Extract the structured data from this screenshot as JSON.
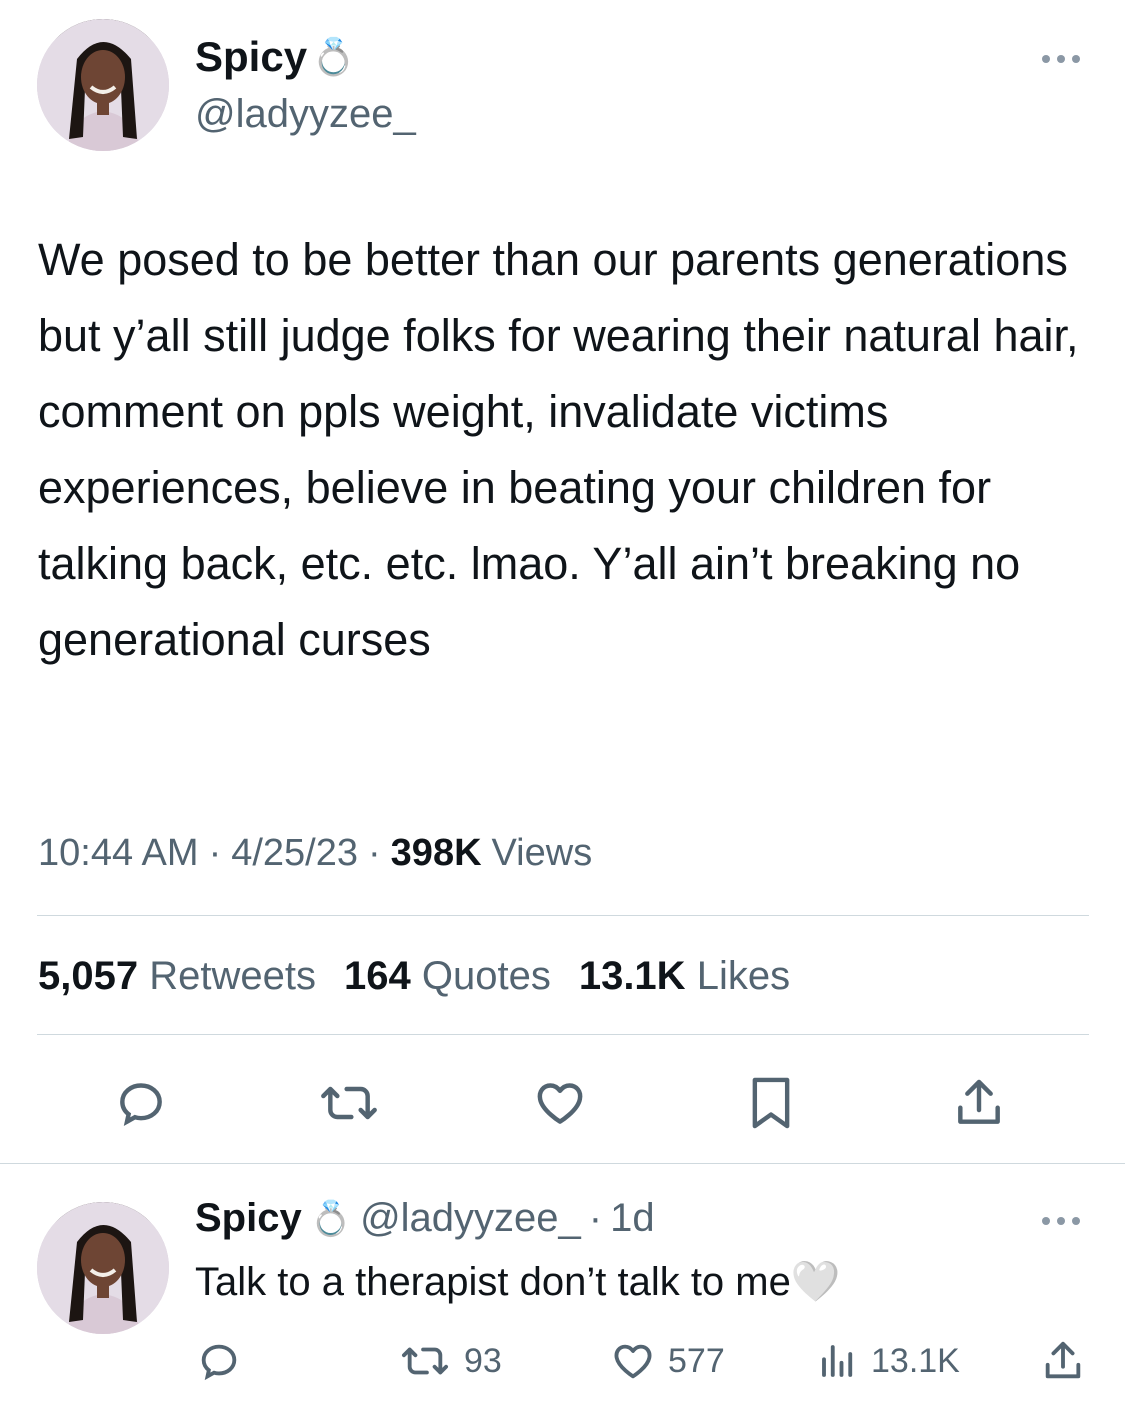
{
  "main_tweet": {
    "author": {
      "display_name": "Spicy",
      "name_emoji": "💍",
      "handle": "@ladyyzee_"
    },
    "more_icon": "more-horizontal-icon",
    "text": "We posed to be better than our parents generations but y’all still judge folks for wearing their natural hair, comment on ppls weight, invalidate victims experiences, believe in beating your children for talking back, etc. etc. lmao. Y’all ain’t breaking no generational curses",
    "time": "10:44 AM",
    "date": "4/25/23",
    "views_count": "398K",
    "views_label": "Views",
    "stats": {
      "retweets_count": "5,057",
      "retweets_label": "Retweets",
      "quotes_count": "164",
      "quotes_label": "Quotes",
      "likes_count": "13.1K",
      "likes_label": "Likes"
    },
    "actions": [
      "reply-icon",
      "retweet-icon",
      "like-icon",
      "bookmark-icon",
      "share-icon"
    ]
  },
  "reply_tweet": {
    "author": {
      "display_name": "Spicy",
      "name_emoji": "💍",
      "handle": "@ladyyzee_",
      "separator": "·",
      "age": "1d"
    },
    "text": "Talk to a therapist don’t talk to me",
    "text_emoji": "🤍",
    "actions": {
      "reply_count": "",
      "retweet_count": "93",
      "like_count": "577",
      "views_count": "13.1K"
    }
  },
  "colors": {
    "text_primary": "#0f1419",
    "text_secondary": "#536471",
    "divider": "#cfd9de"
  }
}
